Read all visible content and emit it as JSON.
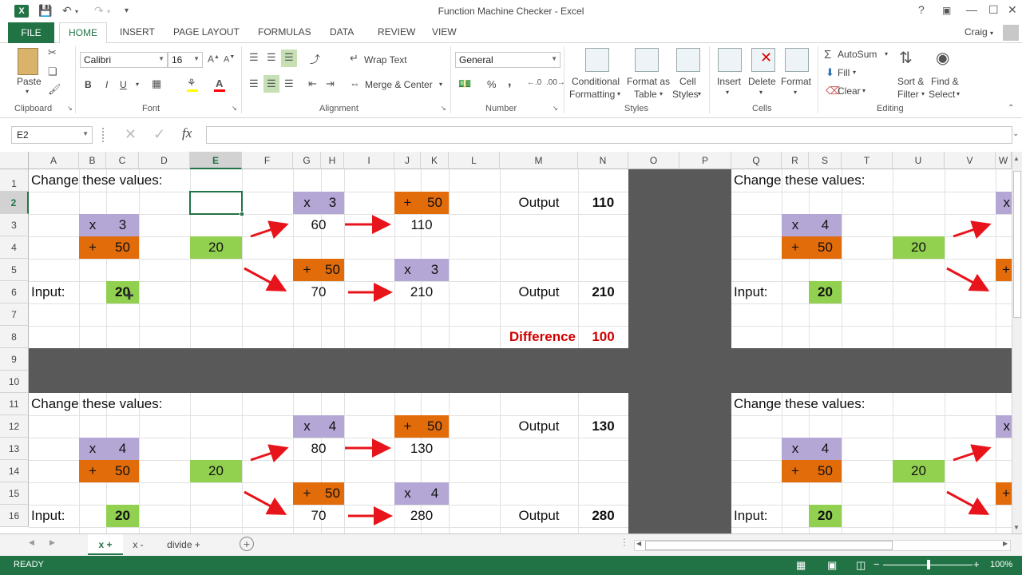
{
  "window": {
    "title": "Function Machine Checker - Excel",
    "user": "Craig",
    "help": "?"
  },
  "tabs": [
    "FILE",
    "HOME",
    "INSERT",
    "PAGE LAYOUT",
    "FORMULAS",
    "DATA",
    "REVIEW",
    "VIEW"
  ],
  "ribbon": {
    "clipboard": {
      "label": "Clipboard",
      "paste": "Paste"
    },
    "font": {
      "label": "Font",
      "name": "Calibri",
      "size": "16",
      "bold": "B",
      "italic": "I",
      "underline": "U"
    },
    "alignment": {
      "label": "Alignment",
      "wrap_text": "Wrap Text",
      "merge_center": "Merge & Center"
    },
    "number": {
      "label": "Number",
      "format": "General",
      "percent": "%",
      "comma": ","
    },
    "styles": {
      "label": "Styles",
      "conditional_1": "Conditional",
      "conditional_2": "Formatting",
      "format_table_1": "Format as",
      "format_table_2": "Table",
      "cell_styles_1": "Cell",
      "cell_styles_2": "Styles"
    },
    "cells": {
      "label": "Cells",
      "insert": "Insert",
      "delete": "Delete",
      "format": "Format"
    },
    "editing": {
      "label": "Editing",
      "autosum": "AutoSum",
      "fill": "Fill",
      "clear": "Clear",
      "sort_1": "Sort &",
      "sort_2": "Filter",
      "find_1": "Find &",
      "find_2": "Select"
    }
  },
  "formula_bar": {
    "name_box": "E2",
    "fx": "fx",
    "value": ""
  },
  "columns": [
    "A",
    "B",
    "C",
    "D",
    "E",
    "F",
    "G",
    "H",
    "I",
    "J",
    "K",
    "L",
    "M",
    "N",
    "O",
    "P",
    "Q",
    "R",
    "S",
    "T",
    "U",
    "V",
    "W"
  ],
  "rows": [
    "1",
    "2",
    "3",
    "4",
    "5",
    "6",
    "7",
    "8",
    "9",
    "10",
    "11",
    "12",
    "13",
    "14",
    "15",
    "16"
  ],
  "cells": {
    "block1": {
      "change_label": "Change these values:",
      "b3_op": "x",
      "c3_val": "3",
      "b4_op": "+",
      "c4_val": "50",
      "input_label": "Input:",
      "c6_input": "20",
      "e4_val": "20",
      "g2_op": "x",
      "h2_val": "3",
      "g3_val": "60",
      "j2_op": "+",
      "k2_val": "50",
      "j3_val": "110",
      "g5_op": "+",
      "h5_val": "50",
      "g6_val": "70",
      "j5_op": "x",
      "k5_val": "3",
      "j6_val": "210",
      "m2_label": "Output",
      "n2_val": "110",
      "m6_label": "Output",
      "n6_val": "210",
      "m8_label": "Difference",
      "n8_val": "100"
    },
    "block2": {
      "change_label": "Change these values:",
      "b13_op": "x",
      "c13_val": "4",
      "b14_op": "+",
      "c14_val": "50",
      "input_label": "Input:",
      "c16_input": "20",
      "e14_val": "20",
      "g12_op": "x",
      "h12_val": "4",
      "g13_val": "80",
      "j12_op": "+",
      "k12_val": "50",
      "j13_val": "130",
      "g15_op": "+",
      "h15_val": "50",
      "g16_val": "70",
      "j15_op": "x",
      "k15_val": "4",
      "j16_val": "280",
      "m12_label": "Output",
      "n12_val": "130",
      "m16_label": "Output",
      "n16_val": "280"
    },
    "block3": {
      "change_label": "Change these values:",
      "r3_op": "x",
      "s3_val": "4",
      "r4_op": "+",
      "s4_val": "50",
      "u4_val": "20",
      "input_label": "Input:",
      "s6_input": "20",
      "w2_op": "x",
      "w5_op": "+"
    },
    "block4": {
      "change_label": "Change these values:",
      "r13_op": "x",
      "s13_val": "4",
      "r14_op": "+",
      "s14_val": "50",
      "u14_val": "20",
      "input_label": "Input:",
      "s16_input": "20",
      "w12_op": "x",
      "w15_op": "+"
    }
  },
  "sheets": [
    {
      "label": "x +",
      "active": true
    },
    {
      "label": "x -",
      "active": false
    },
    {
      "label": "divide +",
      "active": false
    }
  ],
  "status": {
    "text": "READY",
    "zoom": "100%"
  },
  "colors": {
    "accent": "#217346",
    "purple": "#b4a7d6",
    "orange": "#e26b0a",
    "green": "#92d050",
    "dark": "#595959",
    "arrow": "#e8141b",
    "red": "#d00000"
  }
}
